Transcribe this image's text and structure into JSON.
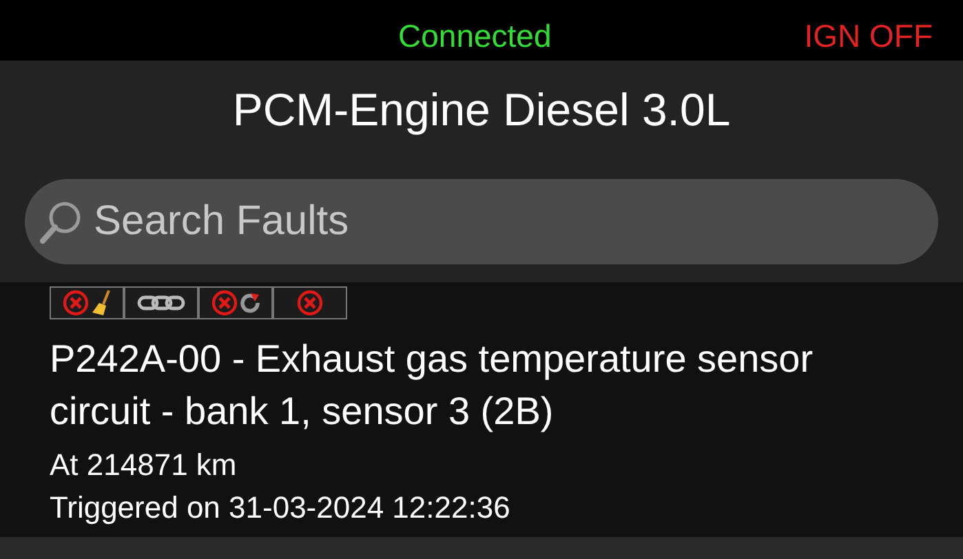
{
  "status_bar": {
    "connection": "Connected",
    "ignition": "IGN OFF"
  },
  "title": "PCM-Engine Diesel 3.0L",
  "search": {
    "placeholder": "Search Faults"
  },
  "faults": [
    {
      "indicators": [
        {
          "kind": "clear-broom"
        },
        {
          "kind": "chain"
        },
        {
          "kind": "clear-reset"
        },
        {
          "kind": "clear"
        }
      ],
      "title": "P242A-00 - Exhaust gas temperature sensor circuit - bank 1, sensor 3 (2B)",
      "odometer": "At 214871 km",
      "triggered": "Triggered on 31-03-2024 12:22:36"
    }
  ]
}
